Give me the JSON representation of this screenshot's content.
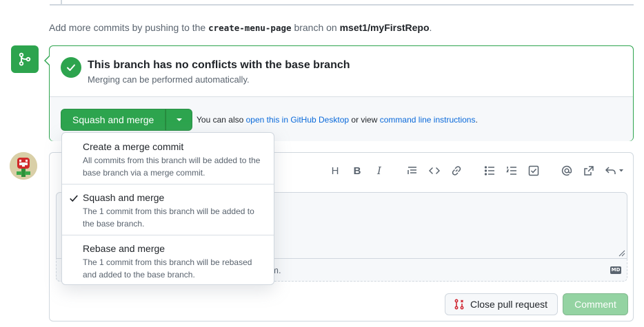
{
  "push_note": {
    "prefix": "Add more commits by pushing to the",
    "branch": "create-menu-page",
    "middle": "branch on",
    "repo": "mset1/myFirstRepo",
    "suffix": "."
  },
  "merge_status": {
    "title": "This branch has no conflicts with the base branch",
    "subtitle": "Merging can be performed automatically."
  },
  "merge_actions": {
    "primary_label": "Squash and merge",
    "also_prefix": "You can also",
    "desktop_link": "open this in GitHub Desktop",
    "or_view": "or view",
    "cli_link": "command line instructions",
    "suffix": "."
  },
  "merge_menu": {
    "selected": "Squash and merge",
    "items": [
      {
        "title": "Create a merge commit",
        "description": "All commits from this branch will be added to the base branch via a merge commit."
      },
      {
        "title": "Squash and merge",
        "description": "The 1 commit from this branch will be added to the base branch."
      },
      {
        "title": "Rebase and merge",
        "description": "The 1 commit from this branch will be rebased and added to the base branch."
      }
    ]
  },
  "toolbar": {
    "heading": "H",
    "bold": "B",
    "italic": "I",
    "icons": [
      "heading-icon",
      "bold-icon",
      "italic-icon",
      "quote-icon",
      "code-icon",
      "link-icon",
      "unordered-list-icon",
      "ordered-list-icon",
      "task-list-icon",
      "mention-icon",
      "reference-icon",
      "reply-icon"
    ]
  },
  "comment": {
    "attach_hint_visible": "sting them.",
    "markdown_badge": "MD",
    "close_label": "Close pull request",
    "comment_label": "Comment"
  },
  "colors": {
    "green": "#2da44e",
    "green_disabled": "#94d3a2",
    "link": "#0969da",
    "muted": "#59636e",
    "close_icon": "#cf222e"
  }
}
